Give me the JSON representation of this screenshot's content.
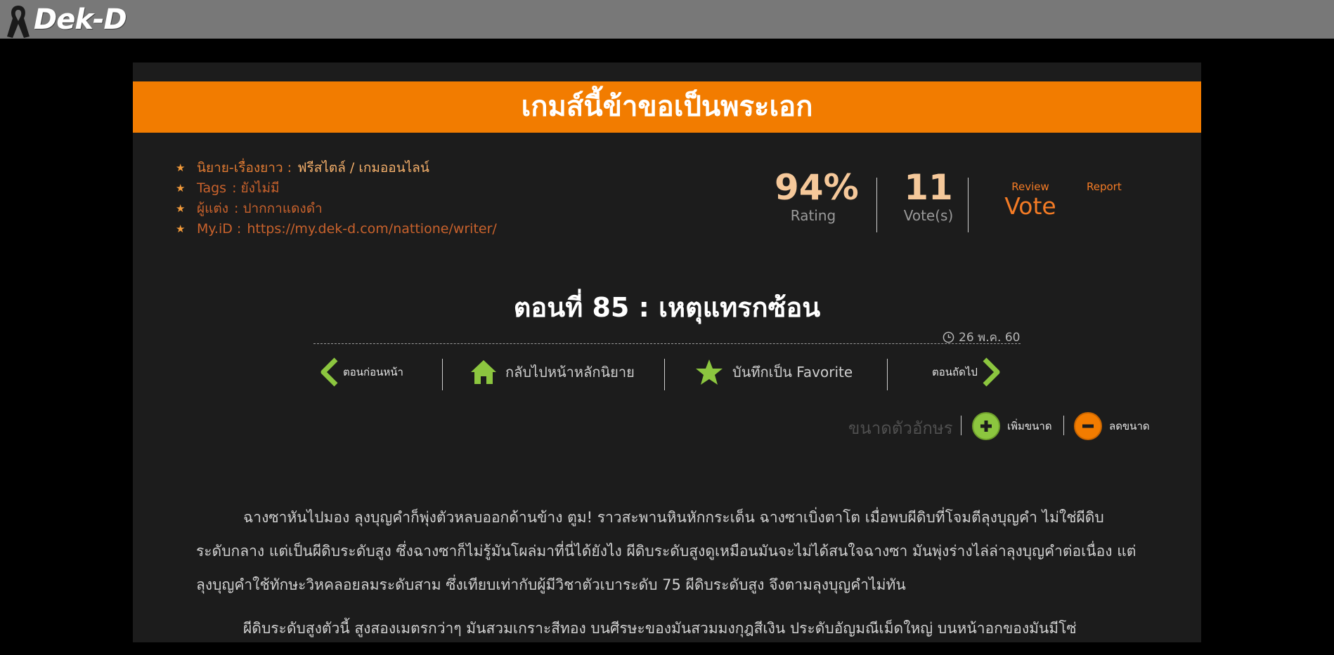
{
  "brand": {
    "logo_text": "Dek-D",
    "ribbon_icon": "black-ribbon-icon"
  },
  "novel": {
    "title": "เกมส์นี้ข้าขอเป็นพระเอก",
    "category_label": "นิยาย-เรื่องยาว :",
    "category_value": "ฟรีสไตล์ / เกมออนไลน์",
    "tags_label": "Tags",
    "tags_value": ": ยังไม่มี",
    "author_label": "ผู้แต่ง",
    "author_value": ": ปากกาแดงดำ",
    "myid_label": "My.iD :",
    "myid_value": "https://my.dek-d.com/nattione/writer/"
  },
  "stats": {
    "rating_value": "94%",
    "rating_label": "Rating",
    "votes_value": "11",
    "votes_label": "Vote(s)",
    "review_label": "Review",
    "vote_label": "Vote",
    "report_label": "Report"
  },
  "chapter": {
    "title": "ตอนที่ 85 : เหตุแทรกซ้อน",
    "date": "26 พ.ค. 60"
  },
  "nav": {
    "prev_label": "ตอนก่อนหน้า",
    "home_label": "กลับไปหน้าหลักนิยาย",
    "favorite_label": "บันทึกเป็น Favorite",
    "next_label": "ตอนถัดไป"
  },
  "font_size": {
    "label": "ขนาดตัวอักษร",
    "increase_label": "เพิ่มขนาด",
    "decrease_label": "ลดขนาด"
  },
  "colors": {
    "accent_orange": "#f27c00",
    "nav_green": "#8cc63f",
    "panel_bg": "#1c1c1c",
    "topbar_bg": "#787878"
  },
  "content": {
    "paragraphs": [
      "ฉางซาหันไปมอง ลุงบุญคำก็พุ่งตัวหลบออกด้านข้าง ตูม! ราวสะพานหินหักกระเด็น ฉางซาเบิ่งตาโต เมื่อพบผีดิบที่โจมตีลุงบุญคำ ไม่ใช่ผีดิบระดับกลาง แต่เป็นผีดิบระดับสูง ซึ่งฉางซาก็ไม่รู้มันโผล่มาที่นี่ได้ยังไง ผีดิบระดับสูงดูเหมือนมันจะไม่ได้สนใจฉางซา มันพุ่งร่างไล่ล่าลุงบุญคำต่อเนื่อง แต่ลุงบุญคำใช้ทักษะวิหคลอยลมระดับสาม ซึ่งเทียบเท่ากับผู้มีวิชาตัวเบาระดับ 75 ผีดิบระดับสูง จึงตามลุงบุญคำไม่ทัน",
      "ผีดิบระดับสูงตัวนี้ สูงสองเมตรกว่าๆ มันสวมเกราะสีทอง บนศีรษะของมันสวมมงกุฎสีเงิน ประดับอัญมณีเม็ดใหญ่ บนหน้าอกของมันมีโซ่"
    ]
  }
}
